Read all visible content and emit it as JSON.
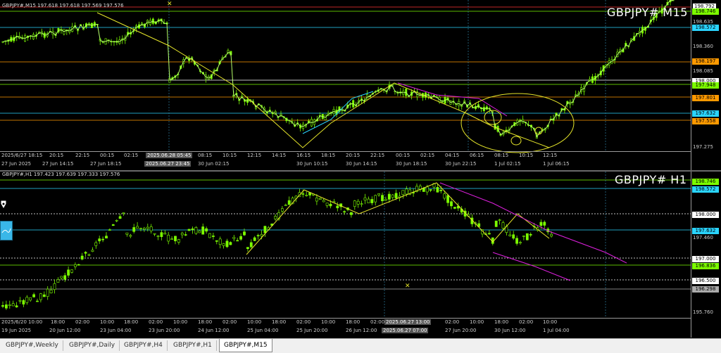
{
  "top_pane": {
    "title": "GBPJPY#,M15  197.618 197.618 197.569 197.576",
    "symbol_label": "GBPJPY# M15",
    "price_labels": [
      "198.792",
      "198.635",
      "198.360",
      "198.085",
      "197.275"
    ],
    "price_tags": [
      {
        "text": "198.746",
        "color": "#7CFC00"
      },
      {
        "text": "198.572",
        "color": "#2ad4ff"
      },
      {
        "text": "198.197",
        "color": "#ff9900"
      },
      {
        "text": "198.000",
        "color": "#ffffff"
      },
      {
        "text": "197.948",
        "color": "#7CFC00"
      },
      {
        "text": "197.801",
        "color": "#ff9900"
      },
      {
        "text": "197.632",
        "color": "#2ad4ff"
      },
      {
        "text": "197.558",
        "color": "#ff9900"
      }
    ],
    "time_labels_upper": [
      "2025/6/27 18:15",
      "20:15",
      "22:15",
      "00:15",
      "02:15",
      "2025.06.28 05:45",
      "08:15",
      "10:15",
      "12:15",
      "14:15",
      "16:15",
      "18:15",
      "20:15",
      "22:15",
      "00:15",
      "02:15",
      "04:15",
      "06:15",
      "08:15",
      "10:15",
      "12:15"
    ],
    "time_labels_lower": [
      "27 Jun 2025",
      "27 Jun 14:15",
      "27 Jun 18:15",
      "2025.06.27 23:45",
      "30 Jun 02:15",
      "30 Jun 10:15",
      "30 Jun 14:15",
      "30 Jun 18:15",
      "30 Jun 22:15",
      "1 Jul 02:15",
      "1 Jul 06:15"
    ]
  },
  "bottom_pane": {
    "title": "GBPJPY#,H1  197.423 197.639 197.333 197.576",
    "symbol_label": "GBPJPY# H1",
    "price_labels": [
      "197.460",
      "195.760"
    ],
    "price_tags": [
      {
        "text": "198.746",
        "color": "#7CFC00"
      },
      {
        "text": "198.572",
        "color": "#2ad4ff"
      },
      {
        "text": "198.000",
        "color": "#ffffff"
      },
      {
        "text": "197.632",
        "color": "#2ad4ff"
      },
      {
        "text": "197.000",
        "color": "#ffffff"
      },
      {
        "text": "196.836",
        "color": "#7CFC00"
      },
      {
        "text": "196.500",
        "color": "#ffffff"
      },
      {
        "text": "196.298",
        "color": "#aaaaaa"
      }
    ],
    "time_labels_upper": [
      "2025/6/20",
      "10:00",
      "18:00",
      "02:00",
      "10:00",
      "18:00",
      "02:00",
      "10:00",
      "18:00",
      "02:00",
      "10:00",
      "18:00",
      "02:00",
      "10:00",
      "18:00",
      "02:00",
      "2025.06.27 13:00",
      "02:00",
      "10:00",
      "18:00",
      "02:00",
      "10:00"
    ],
    "time_labels_lower": [
      "19 Jun 2025",
      "20 Jun 12:00",
      "23 Jun 04:00",
      "23 Jun 20:00",
      "24 Jun 12:00",
      "25 Jun 04:00",
      "25 Jun 20:00",
      "26 Jun 12:00",
      "2025.06.27 07:00",
      "27 Jun 20:00",
      "30 Jun 12:00",
      "1 Jul 04:00"
    ]
  },
  "tabs": [
    "GBPJPY#,Weekly",
    "GBPJPY#,Daily",
    "GBPJPY#,H4",
    "GBPJPY#,H1",
    "GBPJPY#,M15"
  ],
  "active_tab": "GBPJPY#,M15"
}
